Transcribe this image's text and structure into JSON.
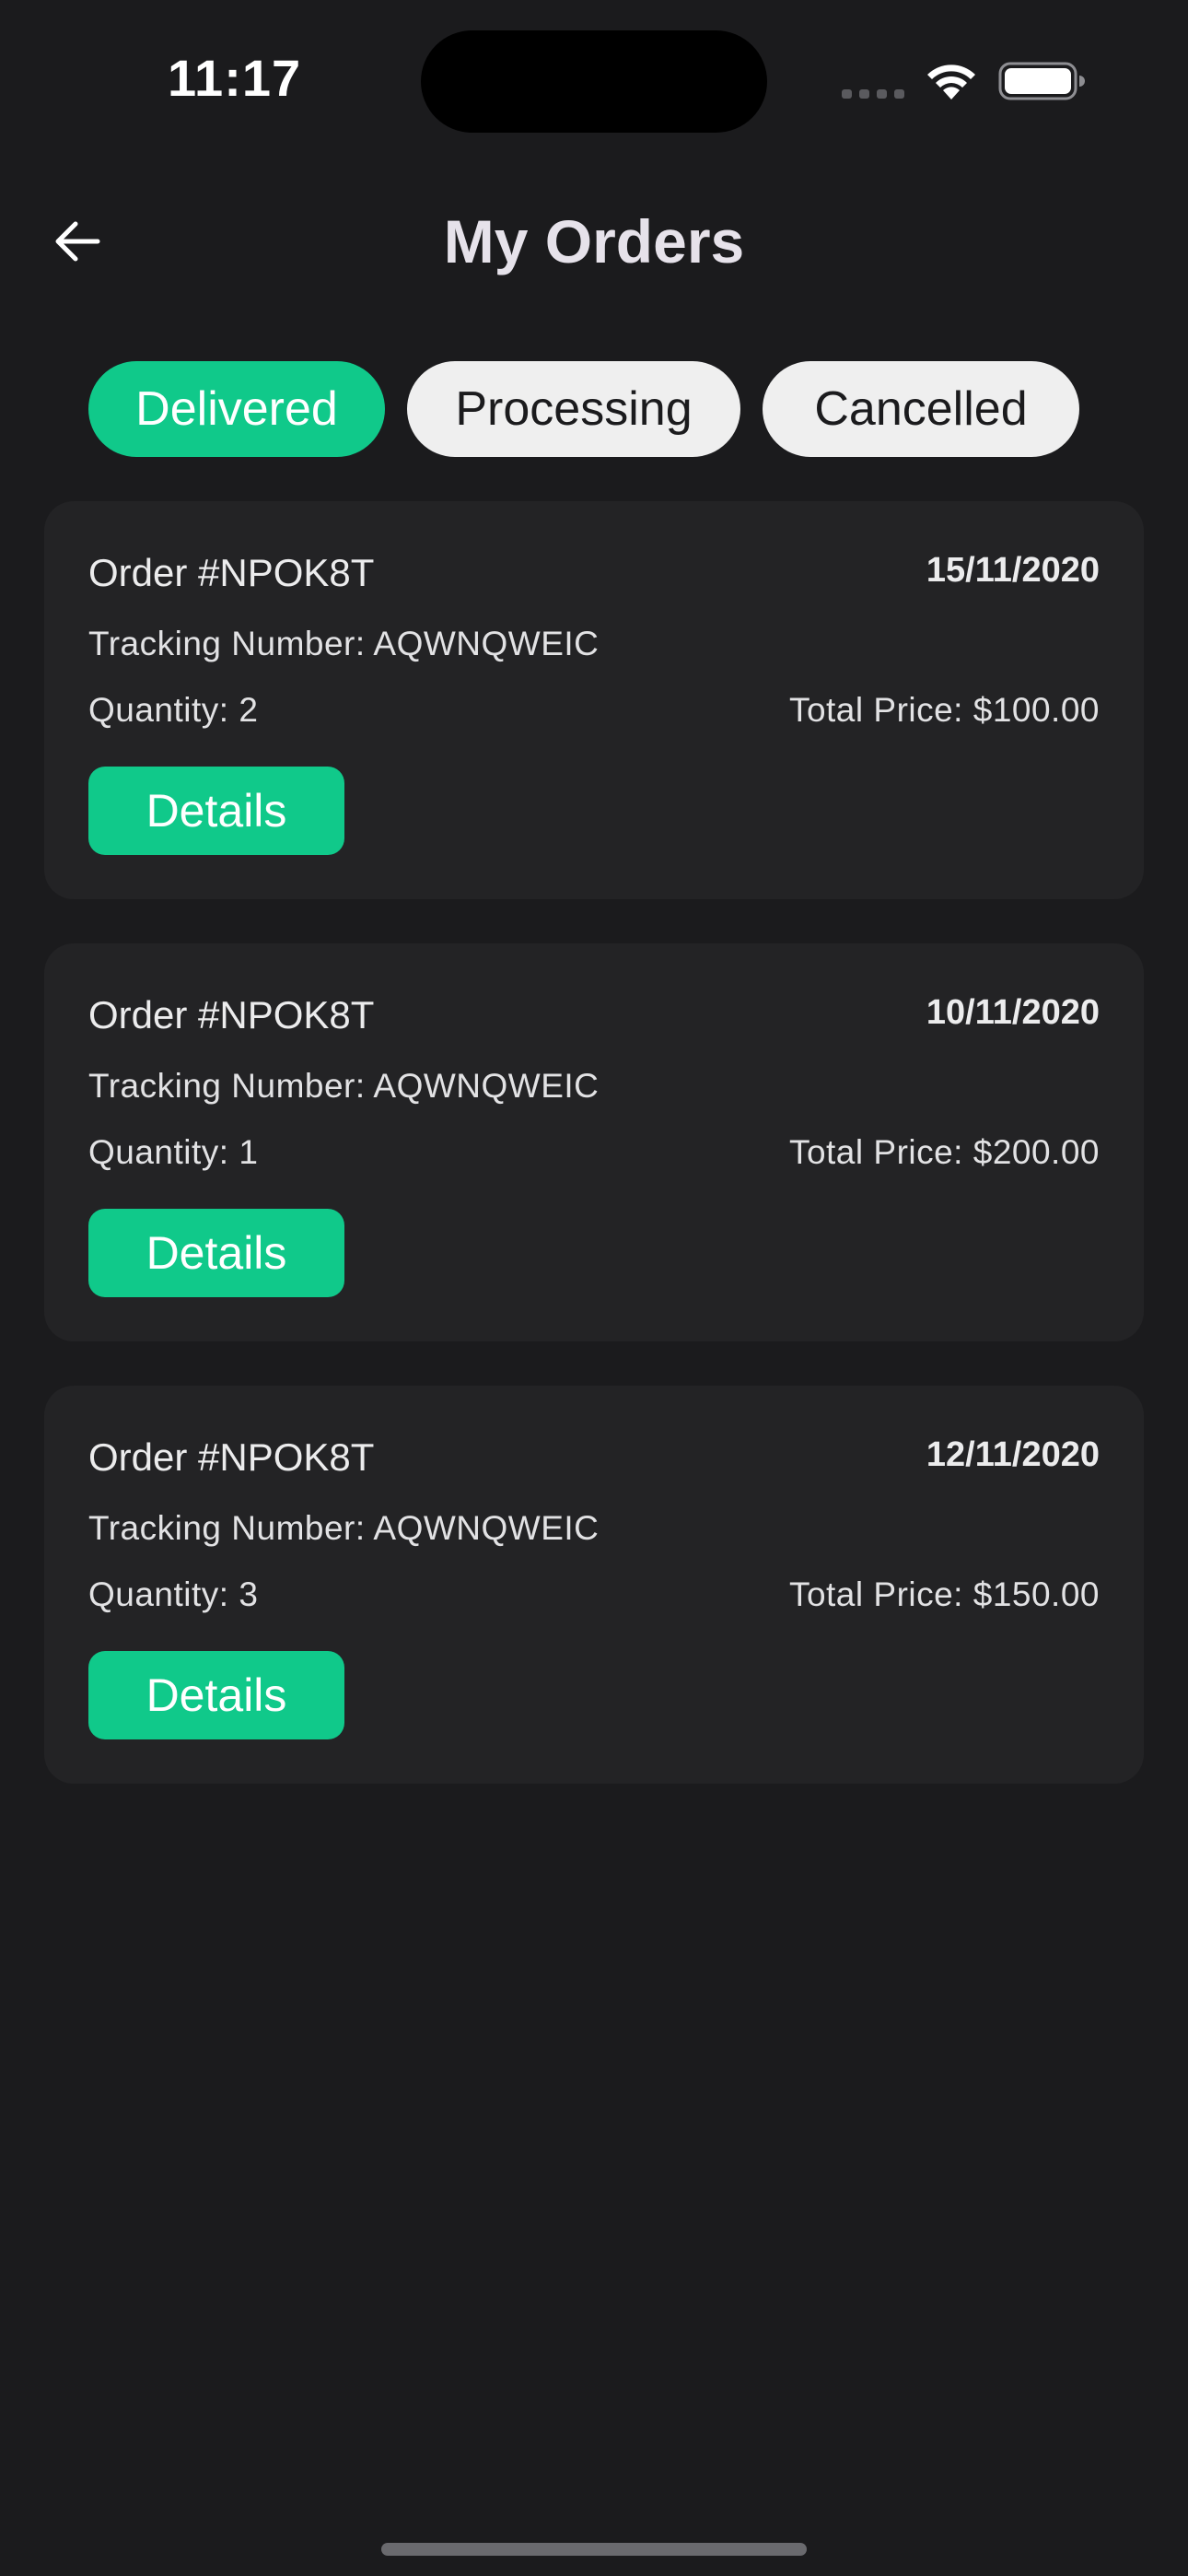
{
  "status_bar": {
    "time": "11:17"
  },
  "header": {
    "title": "My Orders",
    "back_icon": "arrow-left-icon"
  },
  "tabs": [
    {
      "label": "Delivered",
      "active": true
    },
    {
      "label": "Processing",
      "active": false
    },
    {
      "label": "Cancelled",
      "active": false
    }
  ],
  "orders": [
    {
      "order_number": "Order #NPOK8T",
      "date": "15/11/2020",
      "tracking": "Tracking Number: AQWNQWEIC",
      "quantity": "Quantity: 2",
      "total": "Total Price: $100.00",
      "details_label": "Details"
    },
    {
      "order_number": "Order #NPOK8T",
      "date": "10/11/2020",
      "tracking": "Tracking Number: AQWNQWEIC",
      "quantity": "Quantity: 1",
      "total": "Total Price: $200.00",
      "details_label": "Details"
    },
    {
      "order_number": "Order #NPOK8T",
      "date": "12/11/2020",
      "tracking": "Tracking Number: AQWNQWEIC",
      "quantity": "Quantity: 3",
      "total": "Total Price: $150.00",
      "details_label": "Details"
    }
  ],
  "colors": {
    "background": "#1b1b1d",
    "card": "#232325",
    "accent": "#10c98a",
    "inactive_tab": "#efefef"
  }
}
